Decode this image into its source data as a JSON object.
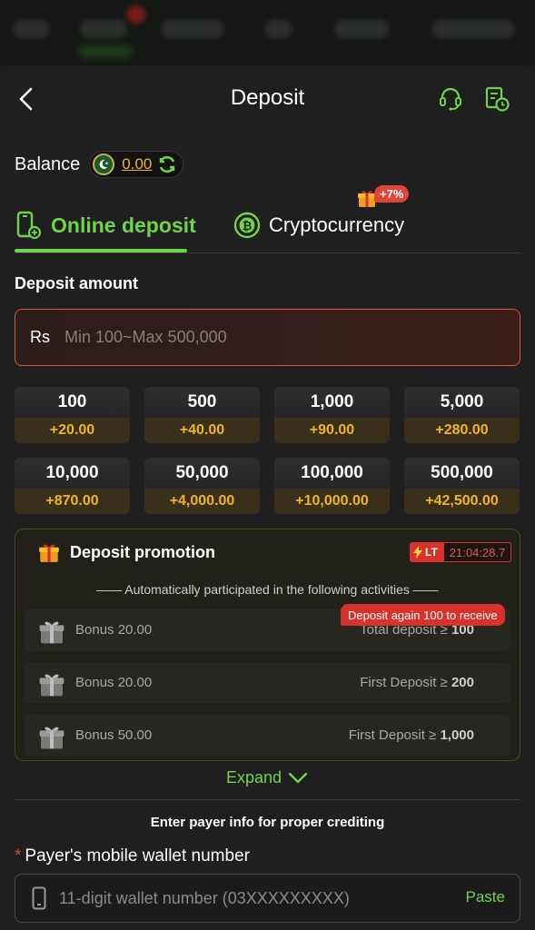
{
  "header": {
    "title": "Deposit"
  },
  "balance": {
    "label": "Balance",
    "value": "0.00"
  },
  "tabs": [
    {
      "label": "Online deposit",
      "active": true
    },
    {
      "label": "Cryptocurrency",
      "active": false,
      "badge": "+7%"
    }
  ],
  "amount": {
    "section_title": "Deposit amount",
    "currency": "Rs",
    "placeholder": "Min 100~Max 500,000"
  },
  "presets": [
    {
      "amount": "100",
      "bonus": "+20.00"
    },
    {
      "amount": "500",
      "bonus": "+40.00"
    },
    {
      "amount": "1,000",
      "bonus": "+90.00"
    },
    {
      "amount": "5,000",
      "bonus": "+280.00"
    },
    {
      "amount": "10,000",
      "bonus": "+870.00"
    },
    {
      "amount": "50,000",
      "bonus": "+4,000.00"
    },
    {
      "amount": "100,000",
      "bonus": "+10,000.00"
    },
    {
      "amount": "500,000",
      "bonus": "+42,500.00"
    }
  ],
  "promotion": {
    "title": "Deposit promotion",
    "timer_badge": "LT",
    "timer": "21:04:28.7",
    "subtitle": "—— Automatically participated in the following activities ——",
    "tip": "Deposit again 100 to receive",
    "items": [
      {
        "label": "Bonus 20.00",
        "condition": "Total deposit ≥",
        "threshold": "100"
      },
      {
        "label": "Bonus 20.00",
        "condition": "First Deposit ≥",
        "threshold": "200"
      },
      {
        "label": "Bonus 50.00",
        "condition": "First Deposit ≥",
        "threshold": "1,000"
      }
    ],
    "expand_label": "Expand"
  },
  "payer": {
    "hint": "Enter payer info for proper crediting",
    "field_label": "Payer's mobile wallet number",
    "required_mark": "*",
    "placeholder": "11-digit wallet number (03XXXXXXXXX)",
    "paste_label": "Paste"
  },
  "colors": {
    "accent": "#6fd44a",
    "gold": "#f0b429",
    "danger": "#d8322c",
    "background": "#1f1f1f"
  },
  "icons": [
    "back-icon",
    "support-headset-icon",
    "history-icon",
    "pakistan-flag-icon",
    "refresh-icon",
    "phone-deposit-icon",
    "bitcoin-icon",
    "gift-icon",
    "chevron-down-icon",
    "mobile-phone-icon"
  ]
}
